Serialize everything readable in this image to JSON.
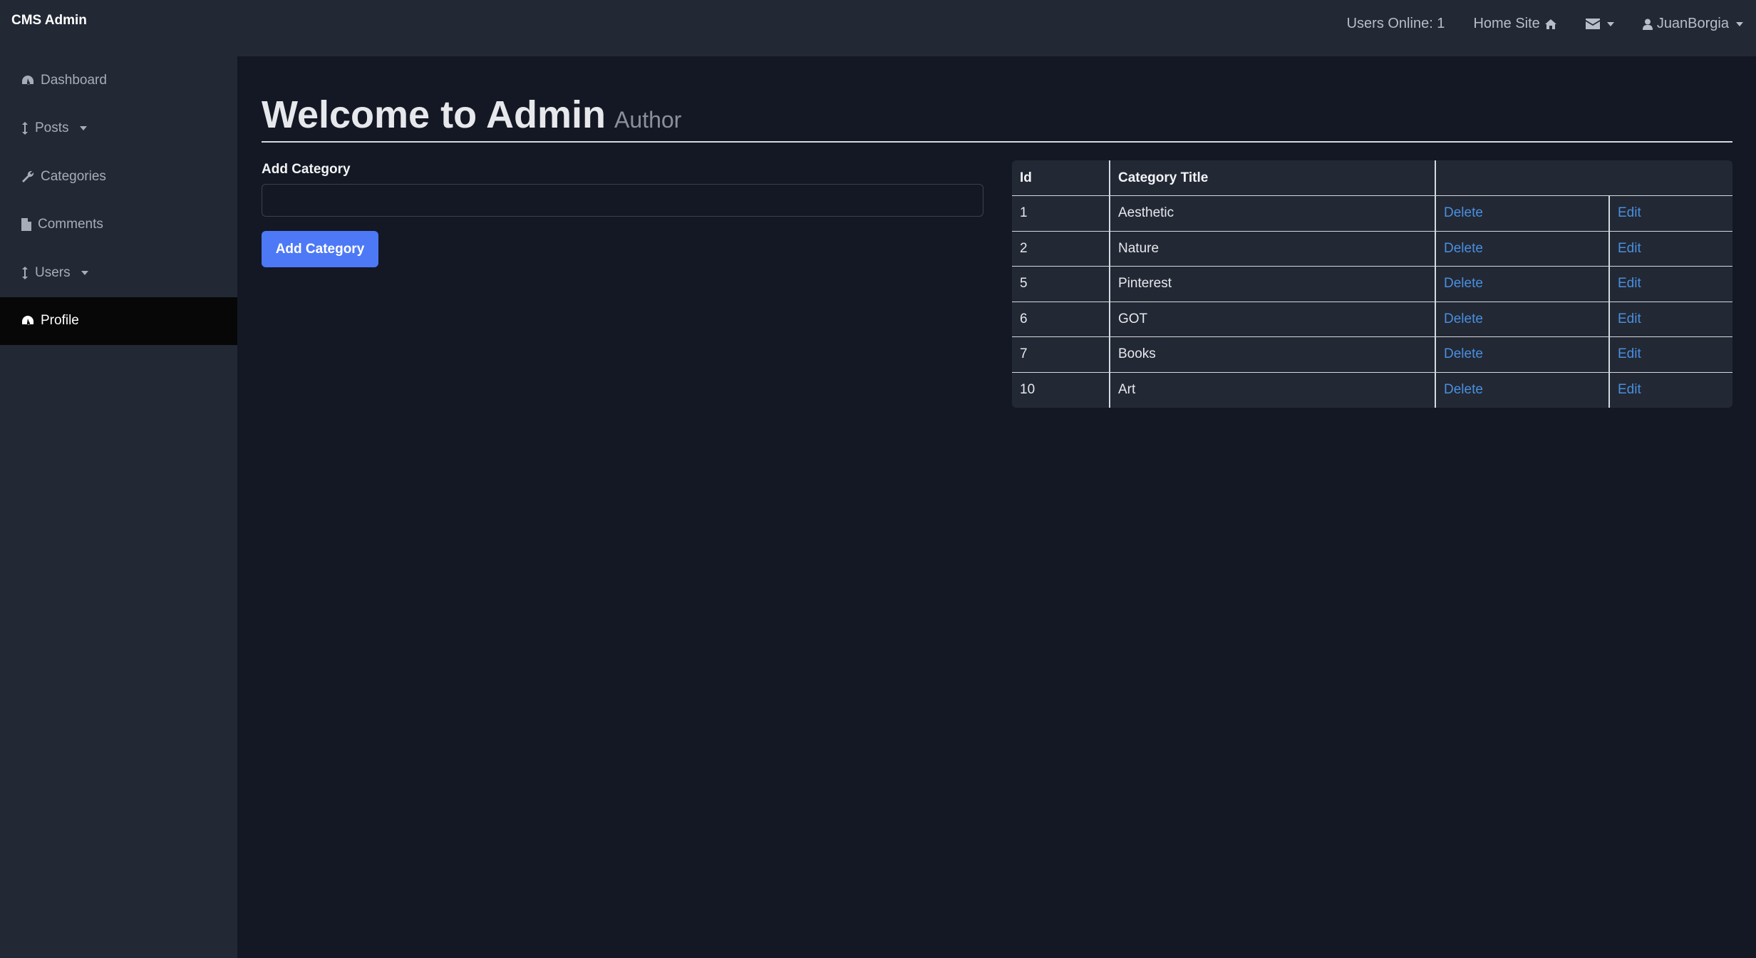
{
  "navbar": {
    "brand": "CMS Admin",
    "users_online": "Users Online: 1",
    "home_site": "Home Site",
    "user": "JuanBorgia"
  },
  "sidebar": {
    "items": [
      {
        "label": "Dashboard",
        "icon": "dashboard-icon",
        "has_caret": false,
        "active": false
      },
      {
        "label": "Posts",
        "icon": "arrows-v-icon",
        "has_caret": true,
        "active": false
      },
      {
        "label": "Categories",
        "icon": "wrench-icon",
        "has_caret": false,
        "active": false
      },
      {
        "label": "Comments",
        "icon": "file-icon",
        "has_caret": false,
        "active": false
      },
      {
        "label": "Users",
        "icon": "arrows-v-icon",
        "has_caret": true,
        "active": false
      },
      {
        "label": "Profile",
        "icon": "dashboard-icon",
        "has_caret": false,
        "active": true
      }
    ]
  },
  "page": {
    "title": "Welcome to Admin",
    "subtitle": "Author"
  },
  "form": {
    "label": "Add Category",
    "input_value": "",
    "button_label": "Add Category"
  },
  "table": {
    "headers": [
      "Id",
      "Category Title",
      ""
    ],
    "rows": [
      {
        "id": "1",
        "title": "Aesthetic",
        "delete": "Delete",
        "edit": "Edit"
      },
      {
        "id": "2",
        "title": "Nature",
        "delete": "Delete",
        "edit": "Edit"
      },
      {
        "id": "5",
        "title": "Pinterest",
        "delete": "Delete",
        "edit": "Edit"
      },
      {
        "id": "6",
        "title": "GOT",
        "delete": "Delete",
        "edit": "Edit"
      },
      {
        "id": "7",
        "title": "Books",
        "delete": "Delete",
        "edit": "Edit"
      },
      {
        "id": "10",
        "title": "Art",
        "delete": "Delete",
        "edit": "Edit"
      }
    ]
  },
  "colors": {
    "background": "#131824",
    "panel": "#222834",
    "accent": "#4d79f6",
    "link": "#4a8fe0",
    "active_sidebar": "#070707"
  }
}
